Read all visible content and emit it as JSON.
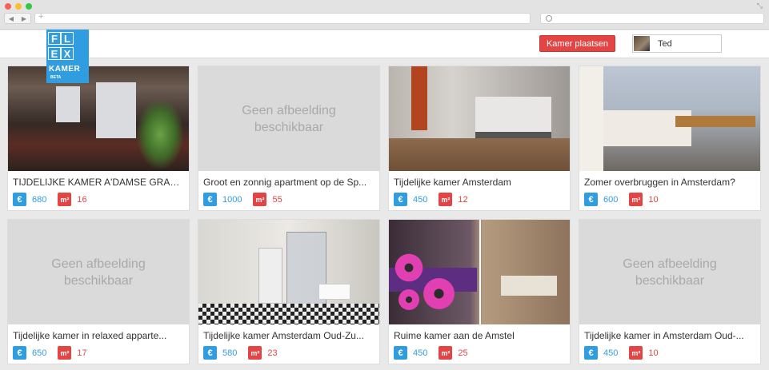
{
  "browser": {
    "new_tab_glyph": "+",
    "resize_glyph": "⤡",
    "back_glyph": "◀",
    "forward_glyph": "▶"
  },
  "header": {
    "logo_letters": [
      "F",
      "L",
      "E",
      "X"
    ],
    "logo_word": "KAMER",
    "logo_badge": "BETA",
    "post_button": "Kamer plaatsen",
    "user_name": "Ted"
  },
  "listings": [
    {
      "title": "TIJDELIJKE KAMER A'DAMSE GRACHT...",
      "price": "680",
      "area": "16",
      "image": "photo"
    },
    {
      "title": "Groot en zonnig apartment op de Sp...",
      "price": "1000",
      "area": "55",
      "image": "placeholder",
      "placeholder_text": "Geen afbeelding beschikbaar"
    },
    {
      "title": "Tijdelijke kamer Amsterdam",
      "price": "450",
      "area": "12",
      "image": "photo"
    },
    {
      "title": "Zomer overbruggen in Amsterdam?",
      "price": "600",
      "area": "10",
      "image": "photo"
    },
    {
      "title": "Tijdelijke kamer in relaxed apparte...",
      "price": "650",
      "area": "17",
      "image": "placeholder",
      "placeholder_text": "Geen afbeelding beschikbaar"
    },
    {
      "title": "Tijdelijke kamer Amsterdam Oud-Zu...",
      "price": "580",
      "area": "23",
      "image": "photo"
    },
    {
      "title": "Ruime kamer aan de Amstel",
      "price": "450",
      "area": "25",
      "image": "photo"
    },
    {
      "title": "Tijdelijke kamer in Amsterdam Oud-...",
      "price": "450",
      "area": "10",
      "image": "placeholder",
      "placeholder_text": "Geen afbeelding beschikbaar"
    }
  ],
  "badges": {
    "euro": "€",
    "sqm": "m²"
  },
  "colors": {
    "brand_blue": "#2f9de0",
    "brand_red": "#e24543"
  }
}
